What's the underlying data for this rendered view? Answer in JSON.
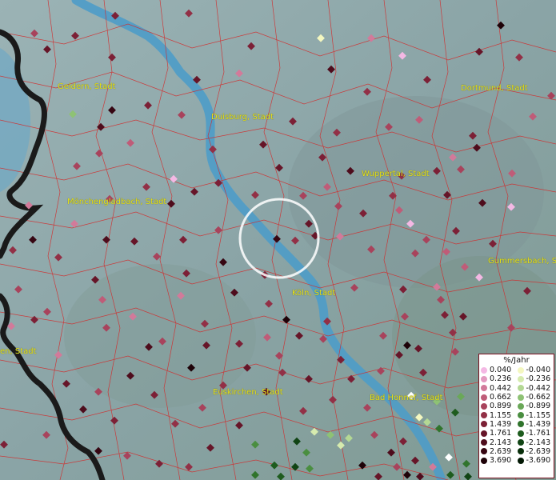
{
  "cities": [
    {
      "id": "geldern",
      "name": "Geldern, Stadt"
    },
    {
      "id": "duisburg",
      "name": "Duisburg, Stadt"
    },
    {
      "id": "dortmund",
      "name": "Dortmund, Stadt"
    },
    {
      "id": "wuppertal",
      "name": "Wuppertal, Stadt"
    },
    {
      "id": "moenchengladbach",
      "name": "Mönchengladbach, Stadt"
    },
    {
      "id": "gummersbach",
      "name": "Gummersbach, Stadt"
    },
    {
      "id": "koeln",
      "name": "Köln, Stadt"
    },
    {
      "id": "edge-left",
      "name": "en, Stadt"
    },
    {
      "id": "euskirchen",
      "name": "Euskirchen, Stadt"
    },
    {
      "id": "badhonnef",
      "name": "Bad Honnef, Stadt"
    }
  ],
  "legend": {
    "title": "%/Jahr",
    "positive": [
      {
        "label": "0.040",
        "color": "#f4b8e4"
      },
      {
        "label": "0.236",
        "color": "#e39ac0"
      },
      {
        "label": "0.442",
        "color": "#d27a9a"
      },
      {
        "label": "0.662",
        "color": "#bf5c78"
      },
      {
        "label": "0.899",
        "color": "#a8435c"
      },
      {
        "label": "1.155",
        "color": "#923046"
      },
      {
        "label": "1.439",
        "color": "#7c2036"
      },
      {
        "label": "1.761",
        "color": "#661528"
      },
      {
        "label": "2.143",
        "color": "#4e0c1c"
      },
      {
        "label": "2.639",
        "color": "#360612"
      },
      {
        "label": "3.690",
        "color": "#1e0208"
      }
    ],
    "negative": [
      {
        "label": "-0.040",
        "color": "#f4f7c0"
      },
      {
        "label": "-0.236",
        "color": "#d6ebae"
      },
      {
        "label": "-0.442",
        "color": "#b4d894"
      },
      {
        "label": "-0.662",
        "color": "#8ec274"
      },
      {
        "label": "-0.899",
        "color": "#6aa858"
      },
      {
        "label": "-1.155",
        "color": "#4a8e40"
      },
      {
        "label": "-1.439",
        "color": "#30742c"
      },
      {
        "label": "-1.761",
        "color": "#1e5c1e"
      },
      {
        "label": "-2.143",
        "color": "#104414"
      },
      {
        "label": "-2.639",
        "color": "#082e0a"
      },
      {
        "label": "-3.690",
        "color": "#021804"
      }
    ]
  }
}
